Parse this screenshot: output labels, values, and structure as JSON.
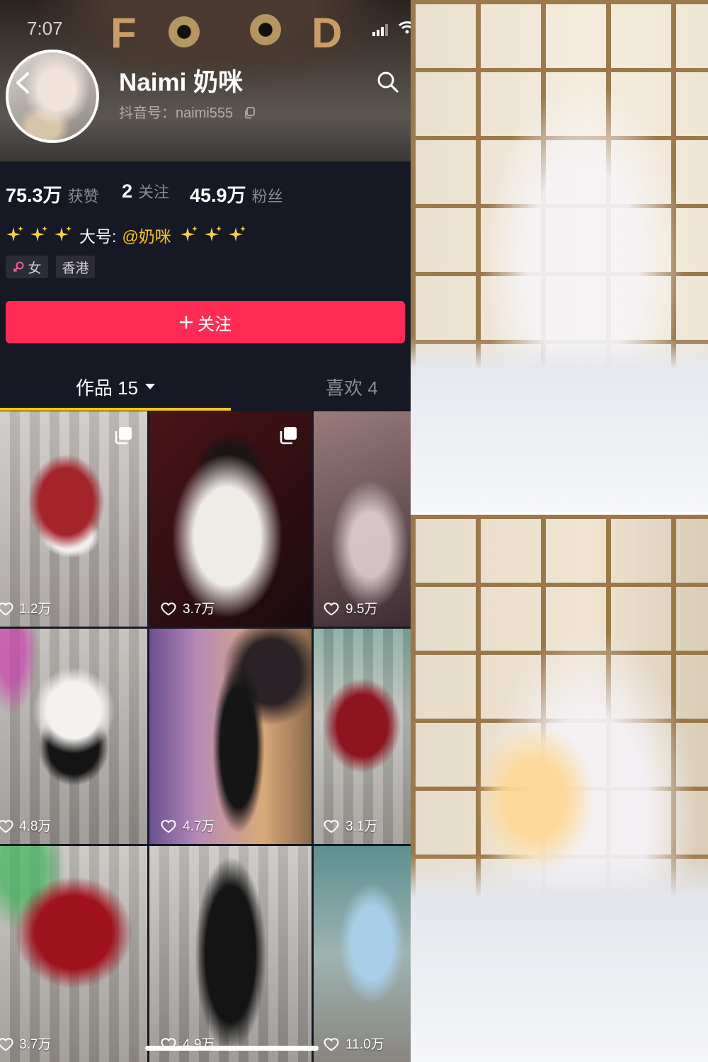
{
  "status_bar": {
    "time": "7:07"
  },
  "banner": {
    "letter_left": "F",
    "letter_right": "D"
  },
  "profile": {
    "name": "Naimi 奶咪",
    "douyin_id": "抖音号：naimi555"
  },
  "stats": [
    {
      "value": "75.3万",
      "label": "获赞"
    },
    {
      "value": "2",
      "label": "关注"
    },
    {
      "value": "45.9万",
      "label": "粉丝"
    }
  ],
  "bio": {
    "label": "大号:",
    "mention": "@奶咪"
  },
  "tags": [
    {
      "icon": "female-icon",
      "label": "女"
    },
    {
      "label": "香港"
    }
  ],
  "follow_button": {
    "icon": "plus-icon",
    "label": "关注"
  },
  "tabs": [
    {
      "label": "作品 15",
      "active": true,
      "icon": "caret-down-icon"
    },
    {
      "label": "喜欢 4",
      "active": false
    }
  ],
  "videos": [
    {
      "likes": "1.2万",
      "multi_image": true
    },
    {
      "likes": "3.7万",
      "multi_image": true
    },
    {
      "likes": "9.5万",
      "multi_image": false
    },
    {
      "likes": "4.8万",
      "multi_image": false
    },
    {
      "likes": "4.7万",
      "multi_image": false
    },
    {
      "likes": "3.1万",
      "multi_image": false
    },
    {
      "likes": "3.7万",
      "multi_image": false
    },
    {
      "likes": "4.9万",
      "multi_image": false
    },
    {
      "likes": "11.0万",
      "multi_image": false
    }
  ],
  "icons": {
    "status": [
      "signal-icon",
      "wifi-icon"
    ],
    "header": [
      "back-arrow-icon",
      "search-icon",
      "copy-icon"
    ],
    "bio": "sparkles-icon",
    "video": [
      "heart-icon",
      "multi-image-icon"
    ]
  },
  "colors": {
    "background": "#161823",
    "accent": "#fe2c55",
    "tab_indicator": "#f5c518",
    "mention": "#f5c518",
    "female": "#f0609a",
    "secondary_text": "#8a8b91"
  }
}
